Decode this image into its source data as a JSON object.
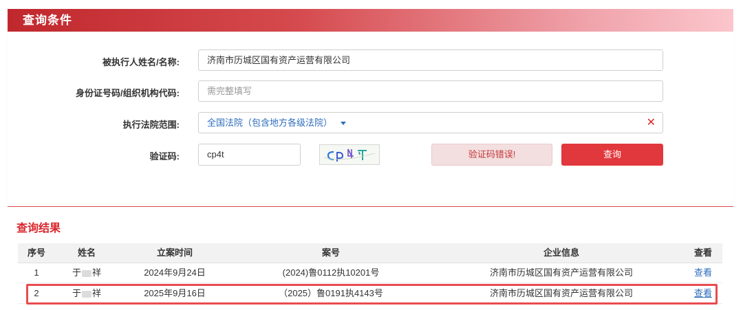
{
  "header": {
    "title": "查询条件"
  },
  "form": {
    "name_label": "被执行人姓名/名称:",
    "name_value": "济南市历城区国有资产运营有限公司",
    "id_label": "身份证号码/组织机构代码:",
    "id_placeholder": "需完整填写",
    "court_label": "执行法院范围:",
    "court_value": "全国法院（包含地方各级法院）",
    "court_caret_icon": "chevron-down-icon",
    "court_clear_icon": "close-icon",
    "captcha_label": "验证码:",
    "captcha_value": "cp4t",
    "captcha_error": "验证码错误!",
    "query_button": "查询"
  },
  "results": {
    "title": "查询结果",
    "columns": [
      "序号",
      "姓名",
      "立案时间",
      "案号",
      "企业信息",
      "查看"
    ],
    "rows": [
      {
        "index": "1",
        "name_first": "于",
        "name_last": "祥",
        "date": "2024年9月24日",
        "case_no": "(2024)鲁0112执10201号",
        "company": "济南市历城区国有资产运营有限公司",
        "view": "查看"
      },
      {
        "index": "2",
        "name_first": "于",
        "name_last": "祥",
        "date": "2025年9月16日",
        "case_no": "（2025）鲁0191执4143号",
        "company": "济南市历城区国有资产运营有限公司",
        "view": "查看"
      }
    ]
  },
  "colors": {
    "accent": "#e1383d",
    "link": "#2d6cbd",
    "highlight": "#e74b4f"
  }
}
